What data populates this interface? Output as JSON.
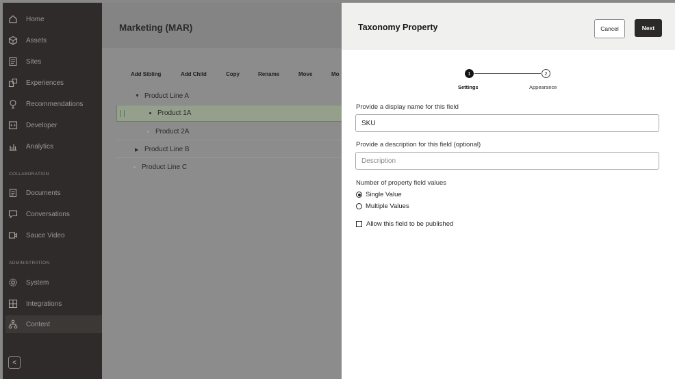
{
  "sidebar": {
    "items": [
      {
        "label": "Home",
        "icon": "home-icon"
      },
      {
        "label": "Assets",
        "icon": "cube-icon"
      },
      {
        "label": "Sites",
        "icon": "sites-icon"
      },
      {
        "label": "Experiences",
        "icon": "experiences-icon"
      },
      {
        "label": "Recommendations",
        "icon": "recommendations-icon"
      },
      {
        "label": "Developer",
        "icon": "code-icon"
      },
      {
        "label": "Analytics",
        "icon": "analytics-icon"
      }
    ],
    "collaboration_label": "COLLABORATION",
    "collab_items": [
      {
        "label": "Documents",
        "icon": "documents-icon"
      },
      {
        "label": "Conversations",
        "icon": "conversations-icon"
      },
      {
        "label": "Sauce Video",
        "icon": "video-icon"
      }
    ],
    "administration_label": "ADMINISTRATION",
    "admin_items": [
      {
        "label": "System",
        "icon": "gear-icon"
      },
      {
        "label": "Integrations",
        "icon": "integrations-icon"
      },
      {
        "label": "Content",
        "icon": "content-icon"
      }
    ],
    "collapse_label": "<"
  },
  "main": {
    "title": "Marketing (MAR)",
    "toolbar": [
      "Add Sibling",
      "Add Child",
      "Copy",
      "Rename",
      "Move",
      "Mo"
    ],
    "tree": [
      {
        "label": "Product Line A",
        "expanded": true
      },
      {
        "label": "Product 1A"
      },
      {
        "label": "Product 2A"
      },
      {
        "label": "Product Line B",
        "expanded": false
      },
      {
        "label": "Product Line C"
      }
    ]
  },
  "drawer": {
    "title": "Taxonomy Property",
    "cancel_label": "Cancel",
    "next_label": "Next",
    "steps": [
      {
        "number": "1",
        "label": "Settings"
      },
      {
        "number": "2",
        "label": "Appearance"
      }
    ],
    "display_name_label": "Provide a display name for this field",
    "display_name_value": "SKU",
    "description_label": "Provide a description for this field (optional)",
    "description_placeholder": "Description",
    "values_label": "Number of property field values",
    "single_value_label": "Single Value",
    "multiple_values_label": "Multiple Values",
    "publish_label": "Allow this field to be published"
  }
}
